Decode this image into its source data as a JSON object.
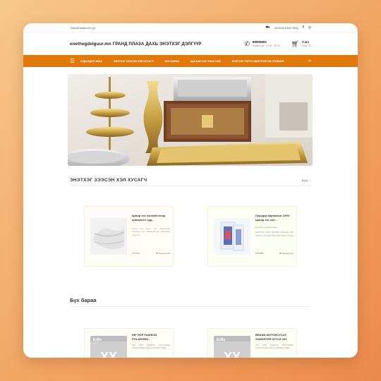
{
  "topbar": {
    "left_text": "Тавтай морилно уу!",
    "right_text": "ЗАХИАЛГЫН ЯВЦ",
    "icons": [
      "truck-icon",
      "facebook-icon",
      "instagram-icon"
    ]
  },
  "header": {
    "brand": "enethegdelguur.mn ГРАНД ПЛАЗА ДАХЬ ЭНЭТХЭГ ДЭЛГҮҮР",
    "phone": "88909691",
    "hours": "Ажлын цаг: 10:00 - 18:00",
    "cart_label": "Сагс",
    "cart_total": "Бүгд: 0₮"
  },
  "nav": {
    "items": [
      "ХУДАЛДАН АВАХ",
      "ЭНЭТХЭГ ЗЭЭСЭН ХЭЛ ХУСАГЧ",
      "БҮХ БАРАА",
      "ЦАГААН САР УНАХ САЙ",
      "ЭНЭТХЭГ ГОРГО ИМЭТРЭЭТЭЭ СТОВОУР"
    ],
    "accent": "#e0780a"
  },
  "section1": {
    "title": "ЭНЭТХЭГ ЗЭЭСЭН ХЭЛ ХУСАГЧ",
    "see_all": "Бүгд →"
  },
  "products1": [
    {
      "title": "Цэвэр зэс хэлний ногор цэвэрлэгч худ...",
      "desc": "Зэсэн хэл хусагч бол Энэтхэгийн Аюурвед түүх уламжлалтай хэрэглэдэг хэрэгсэл...",
      "price": "15'000₮",
      "compare": "Харьцуулах"
    },
    {
      "title": "Лүүхдэр коряжгын 100% Цэвэр зэс хэл...",
      "desc": "Коряжгын хэлний хусагч",
      "desc2": "ЭНЭТХЭГ 100% ЗЭСЭЭР ХИЙСЭН ХЭЛ ХУСАГЧ НЬ ЭНЭТХЭГ ЭКСПОРТ ЧАНАР",
      "price": "15'000₮",
      "compare": "Харьцуулах"
    }
  ],
  "section2": {
    "title": "Бүх бараа"
  },
  "products2": [
    {
      "title": "HIP HOP FASHION POLARIZED...",
      "desc": "HIP HOP FASHION POLARIZED SUNGLASSES MEN & WOMEN TEEN...",
      "brand_mark": "XX"
    },
    {
      "title": "BRAND MOTORCYCLE GANGSTER STYLE #03",
      "desc": "HIP HOP FASHION POLARIZED SUNGLASSES MEN & WOMEN TEEN...",
      "brand_mark": "XX"
    }
  ]
}
